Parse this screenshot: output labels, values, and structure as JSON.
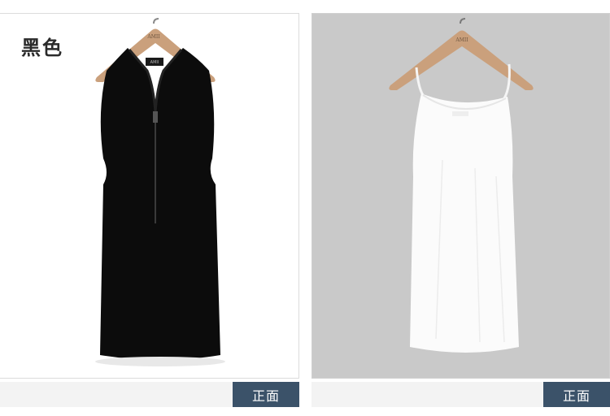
{
  "left_panel": {
    "color_label": "黑色",
    "hanger_brand": "AMII",
    "caption_button": "正面",
    "garment_color": "#0c0c0c"
  },
  "right_panel": {
    "hanger_brand": "AMII",
    "caption_button": "正面",
    "garment_color": "#fbfbfb",
    "background_color": "#c9c9c9"
  },
  "colors": {
    "button_bg": "#3b5269",
    "hanger_wood": "#c9a27e"
  }
}
